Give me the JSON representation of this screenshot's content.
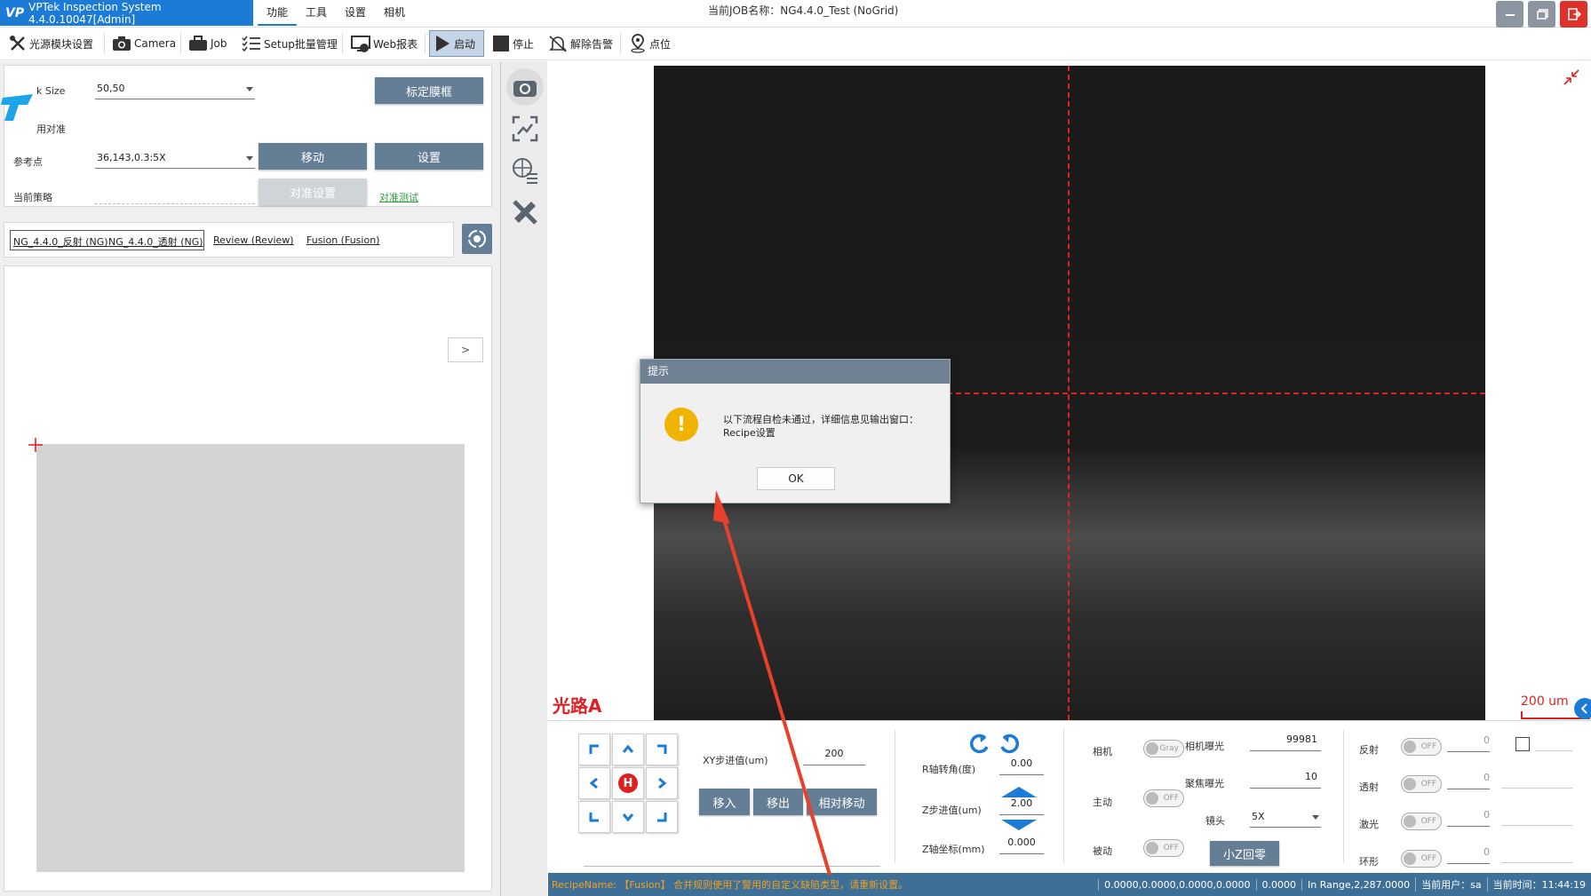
{
  "app": {
    "title": "VPTek Inspection System 4.4.0.10047[Admin]",
    "logo": "VP",
    "job_name": "当前JOB名称：NG4.4.0_Test (NoGrid)"
  },
  "menu": [
    "功能",
    "工具",
    "设置",
    "相机"
  ],
  "toolbar": {
    "light_module": "光源模块设置",
    "camera": "Camera",
    "job": "Job",
    "setup_batch": "Setup批量管理",
    "web_report": "Web报表",
    "start": "启动",
    "stop": "停止",
    "clear_alarm": "解除告警",
    "point": "点位"
  },
  "alignment": {
    "mark_size_label": "k Size",
    "mark_size_value": "50,50",
    "calibrate_button": "标定膜框",
    "enable_align_label": "用对准",
    "ref_point_label": "参考点",
    "ref_point_value": "36,143,0.3:5X",
    "move_button": "移动",
    "set_button": "设置",
    "strategy_label": "当前策略",
    "align_settings_button": "对准设置",
    "align_test_link": "对准测试"
  },
  "recipe_tabs": [
    "NG_4.4.0_反射 (NG)",
    "NG_4.4.0_透射 (NG)",
    "Review (Review)",
    "Fusion (Fusion)"
  ],
  "map_panel": {
    "expand_button": ">"
  },
  "camera_view": {
    "light_path": "光路A",
    "scale_label": "200 um"
  },
  "dialog": {
    "title": "提示",
    "message_line1": "以下流程自检未通过，详细信息见输出窗口：",
    "message_line2": "Recipe设置",
    "ok_button": "OK",
    "icon_glyph": "!"
  },
  "stage": {
    "home_label": "H",
    "xy_step_label": "XY步进值(um)",
    "xy_step_value": "200",
    "move_in": "移入",
    "move_out": "移出",
    "relative_move": "相对移动",
    "r_angle_label": "R轴转角(度)",
    "r_angle_value": "0.00",
    "z_step_label": "Z步进值(um)",
    "z_step_value": "2.00",
    "z_coord_label": "Z轴坐标(mm)",
    "z_coord_value": "0.000",
    "small_z_zero": "小Z回零"
  },
  "camera_ctrl": {
    "camera_label": "相机",
    "camera_toggle": "Gray",
    "exposure_label": "相机曝光",
    "exposure_value": "99981",
    "active_label": "主动",
    "active_toggle": "OFF",
    "focus_label": "聚焦曝光",
    "focus_value": "10",
    "lens_label": "镜头",
    "lens_value": "5X",
    "passive_label": "被动",
    "passive_toggle": "OFF"
  },
  "lights": [
    {
      "label": "反射",
      "toggle": "OFF",
      "value": "0"
    },
    {
      "label": "透射",
      "toggle": "OFF",
      "value": "0"
    },
    {
      "label": "激光",
      "toggle": "OFF",
      "value": "0"
    },
    {
      "label": "环形",
      "toggle": "OFF",
      "value": "0"
    }
  ],
  "status": {
    "recipe_warning": "RecipeName: 【Fusion】 合并规则使用了警用的自定义缺陷类型，请重新设置。",
    "coords": "0.0000,0.0000,0.0000,0.0000",
    "value": "0.0000",
    "range": "In Range,2,287.0000",
    "user": "当前用户：sa",
    "time": "当前时间：11:44:19"
  },
  "colors": {
    "brand_blue": "#1c7bd6",
    "button_gray": "#647f95",
    "status_bar": "#3e6f96",
    "crosshair_red": "#e02020",
    "warning_orange": "#f0a020",
    "close_red": "#e0302a"
  }
}
